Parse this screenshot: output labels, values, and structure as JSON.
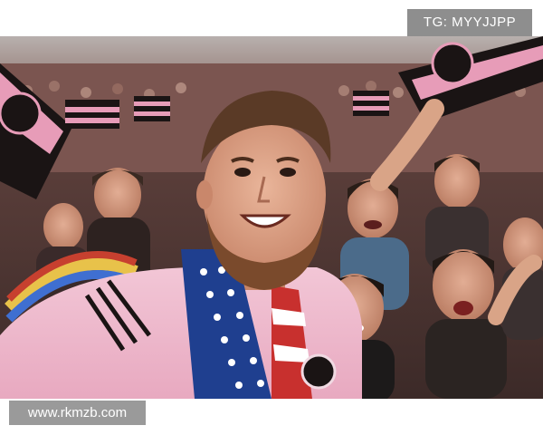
{
  "image": {
    "description_icon": "photo-image"
  },
  "watermarks": {
    "top_right": "TG: MYYJJPP",
    "bottom_left": "www.rkmzb.com"
  }
}
